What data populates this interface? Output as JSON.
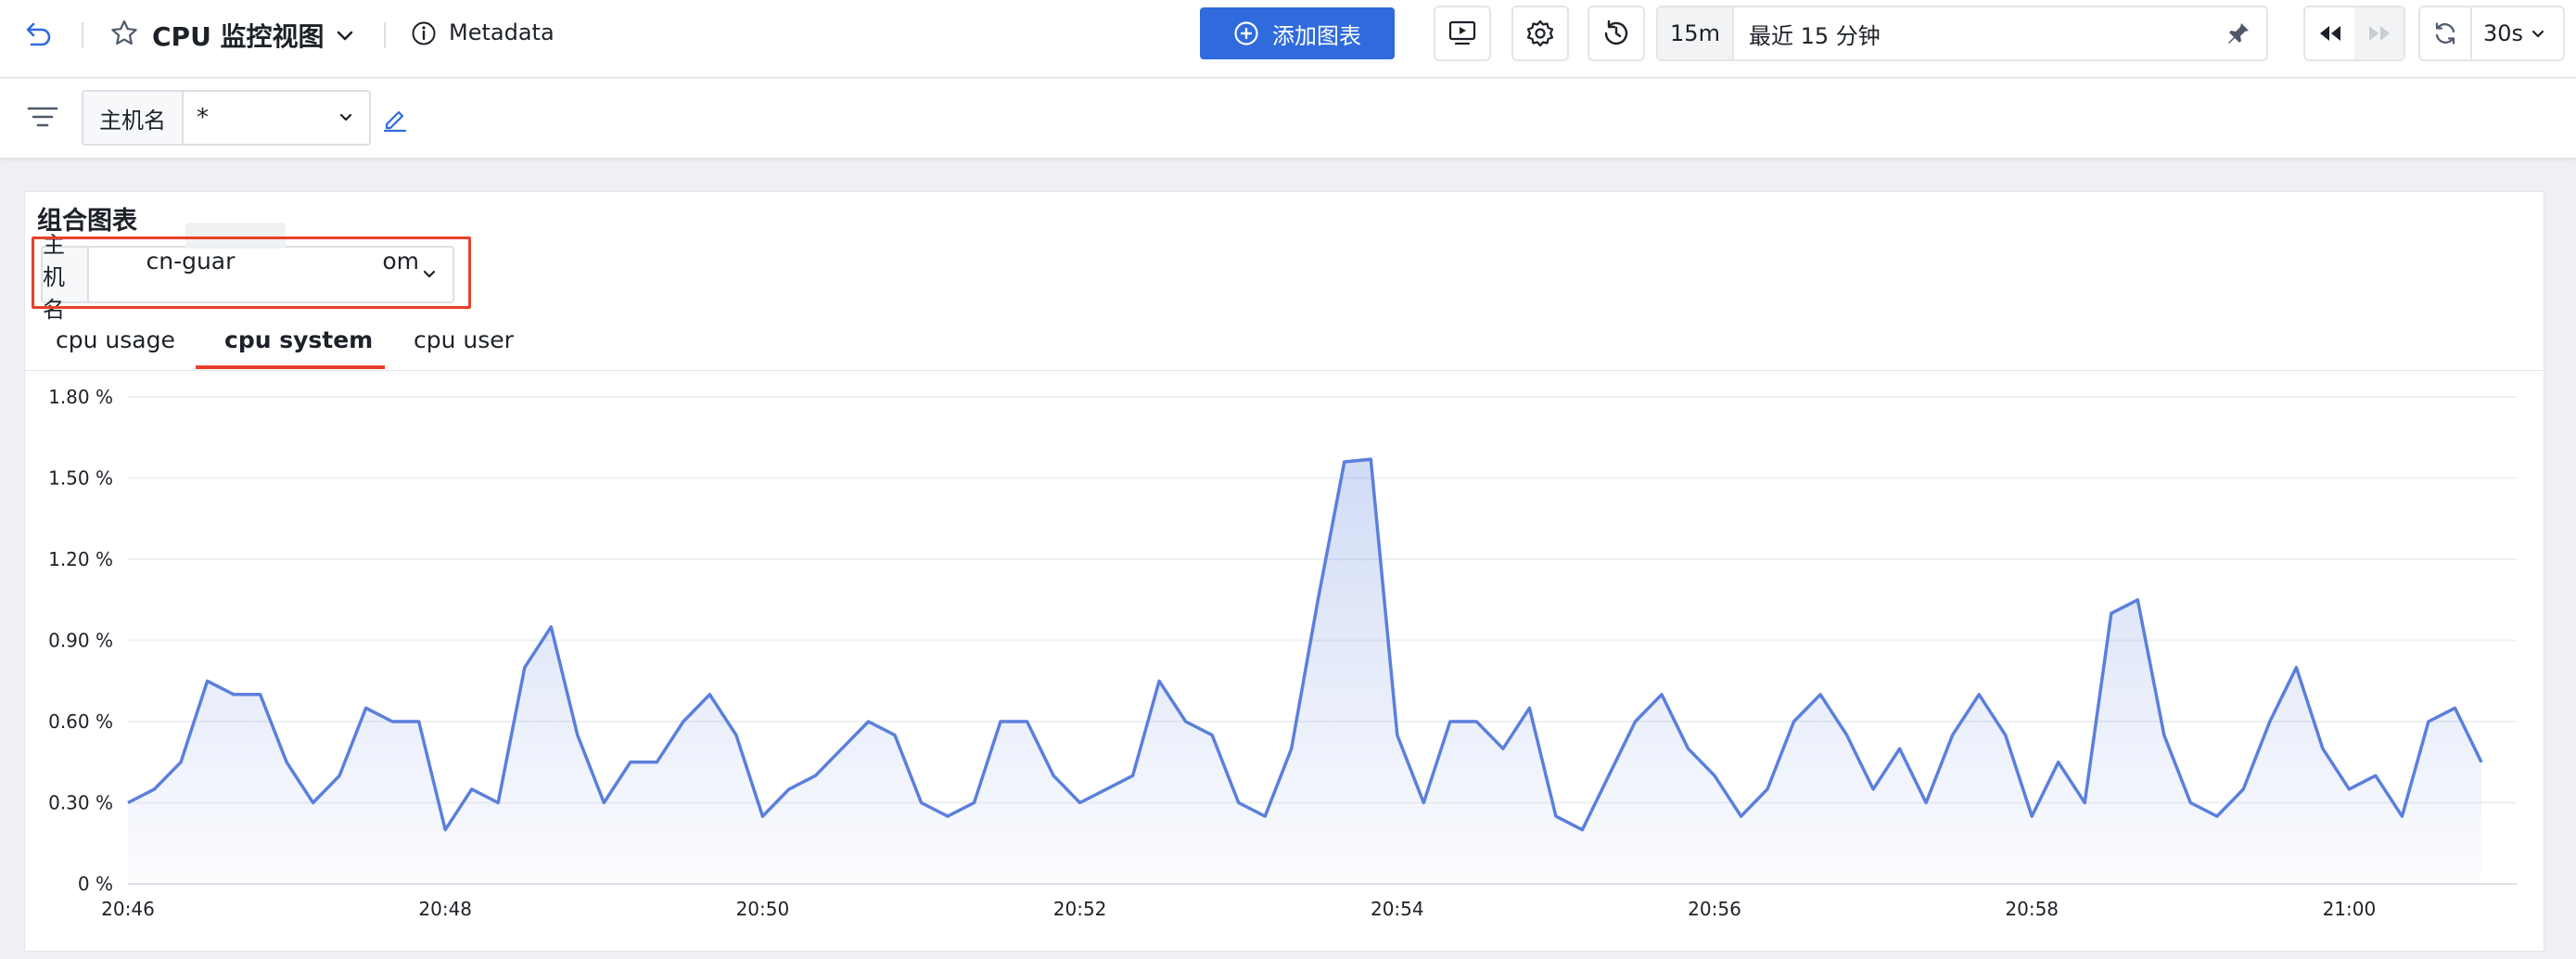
{
  "header": {
    "dashboard_title": "CPU 监控视图",
    "metadata_label": "Metadata",
    "add_chart_label": "添加图表",
    "time_short": "15m",
    "time_label": "最近 15 分钟",
    "refresh_interval": "30s"
  },
  "filters": {
    "host_label": "主机名",
    "host_value": "*"
  },
  "panel": {
    "title": "组合图表",
    "host_label": "主机名",
    "host_value": "cn-guar                    om",
    "tabs": [
      {
        "label": "cpu usage",
        "active": false
      },
      {
        "label": "cpu system",
        "active": true
      },
      {
        "label": "cpu user",
        "active": false
      }
    ]
  },
  "colors": {
    "accent": "#2f6bdc",
    "line": "#5b7fdc",
    "highlight": "#e8402a"
  },
  "chart_data": {
    "type": "area",
    "title": "",
    "xlabel": "",
    "ylabel": "",
    "ylim": [
      0,
      1.8
    ],
    "yticks": [
      "0 %",
      "0.30 %",
      "0.60 %",
      "0.90 %",
      "1.20 %",
      "1.50 %",
      "1.80 %"
    ],
    "x_ticks": [
      "20:46",
      "20:48",
      "20:50",
      "20:52",
      "20:54",
      "20:56",
      "20:58",
      "21:00"
    ],
    "x_start": "20:46:00",
    "interval_seconds": 10,
    "grid": true,
    "series": [
      {
        "values": [
          0.3,
          0.35,
          0.45,
          0.75,
          0.7,
          0.7,
          0.45,
          0.3,
          0.4,
          0.65,
          0.6,
          0.6,
          0.2,
          0.35,
          0.3,
          0.8,
          0.95,
          0.55,
          0.3,
          0.45,
          0.45,
          0.6,
          0.7,
          0.55,
          0.25,
          0.35,
          0.4,
          0.5,
          0.6,
          0.55,
          0.3,
          0.25,
          0.3,
          0.6,
          0.6,
          0.4,
          0.3,
          0.35,
          0.4,
          0.75,
          0.6,
          0.55,
          0.3,
          0.25,
          0.5,
          1.05,
          1.56,
          1.57,
          0.55,
          0.3,
          0.6,
          0.6,
          0.5,
          0.65,
          0.25,
          0.2,
          0.4,
          0.6,
          0.7,
          0.5,
          0.4,
          0.25,
          0.35,
          0.6,
          0.7,
          0.55,
          0.35,
          0.5,
          0.3,
          0.55,
          0.7,
          0.55,
          0.25,
          0.45,
          0.3,
          1.0,
          1.05,
          0.55,
          0.3,
          0.25,
          0.35,
          0.6,
          0.8,
          0.5,
          0.35,
          0.4,
          0.25,
          0.6,
          0.65,
          0.45
        ]
      }
    ]
  }
}
